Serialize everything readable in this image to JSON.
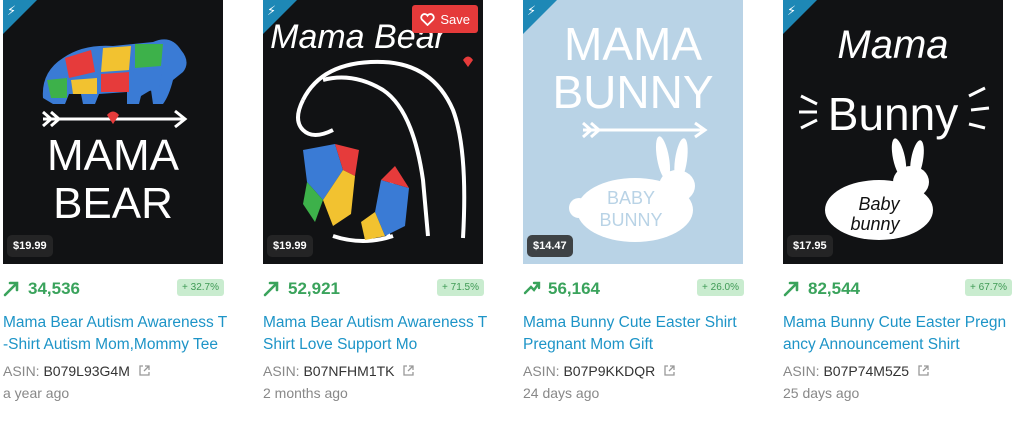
{
  "products": [
    {
      "price": "$19.99",
      "rank": "34,536",
      "change": "+ 32.7%",
      "title": "Mama Bear Autism Awareness T-Shirt Autism Mom,Mommy Tee",
      "asin_label": "ASIN:",
      "asin": "B079L93G4M",
      "age": "a year ago",
      "art": [
        "MAMA",
        "BEAR"
      ]
    },
    {
      "price": "$19.99",
      "rank": "52,921",
      "change": "+ 71.5%",
      "title": "Mama Bear Autism Awareness T Shirt Love Support Mo",
      "asin_label": "ASIN:",
      "asin": "B07NFHM1TK",
      "age": "2 months ago",
      "save_label": "Save",
      "art": [
        "Mama Bear"
      ]
    },
    {
      "price": "$14.47",
      "rank": "56,164",
      "change": "+ 26.0%",
      "title": "Mama Bunny Cute Easter Shirt Pregnant Mom Gift",
      "asin_label": "ASIN:",
      "asin": "B07P9KKDQR",
      "age": "24 days ago",
      "art": [
        "MAMA",
        "BUNNY",
        "BABY",
        "BUNNY"
      ]
    },
    {
      "price": "$17.95",
      "rank": "82,544",
      "change": "+ 67.7%",
      "title": "Mama Bunny Cute Easter Pregnancy Announcement Shirt",
      "asin_label": "ASIN:",
      "asin": "B07P74M5Z5",
      "age": "25 days ago",
      "art": [
        "Mama",
        "Bunny",
        "Baby",
        "bunny"
      ]
    }
  ],
  "colors": {
    "rank_green": "#3aa35c",
    "link_blue": "#1d94c7",
    "badge_green": "#c9eccf",
    "save_red": "#e53a3a",
    "bolt_blue": "#1e88b6"
  },
  "icons": {
    "corner": "lightning-icon",
    "trend": "trend-up-arrow-icon",
    "save": "heart-icon",
    "asin_link": "external-link-icon"
  }
}
